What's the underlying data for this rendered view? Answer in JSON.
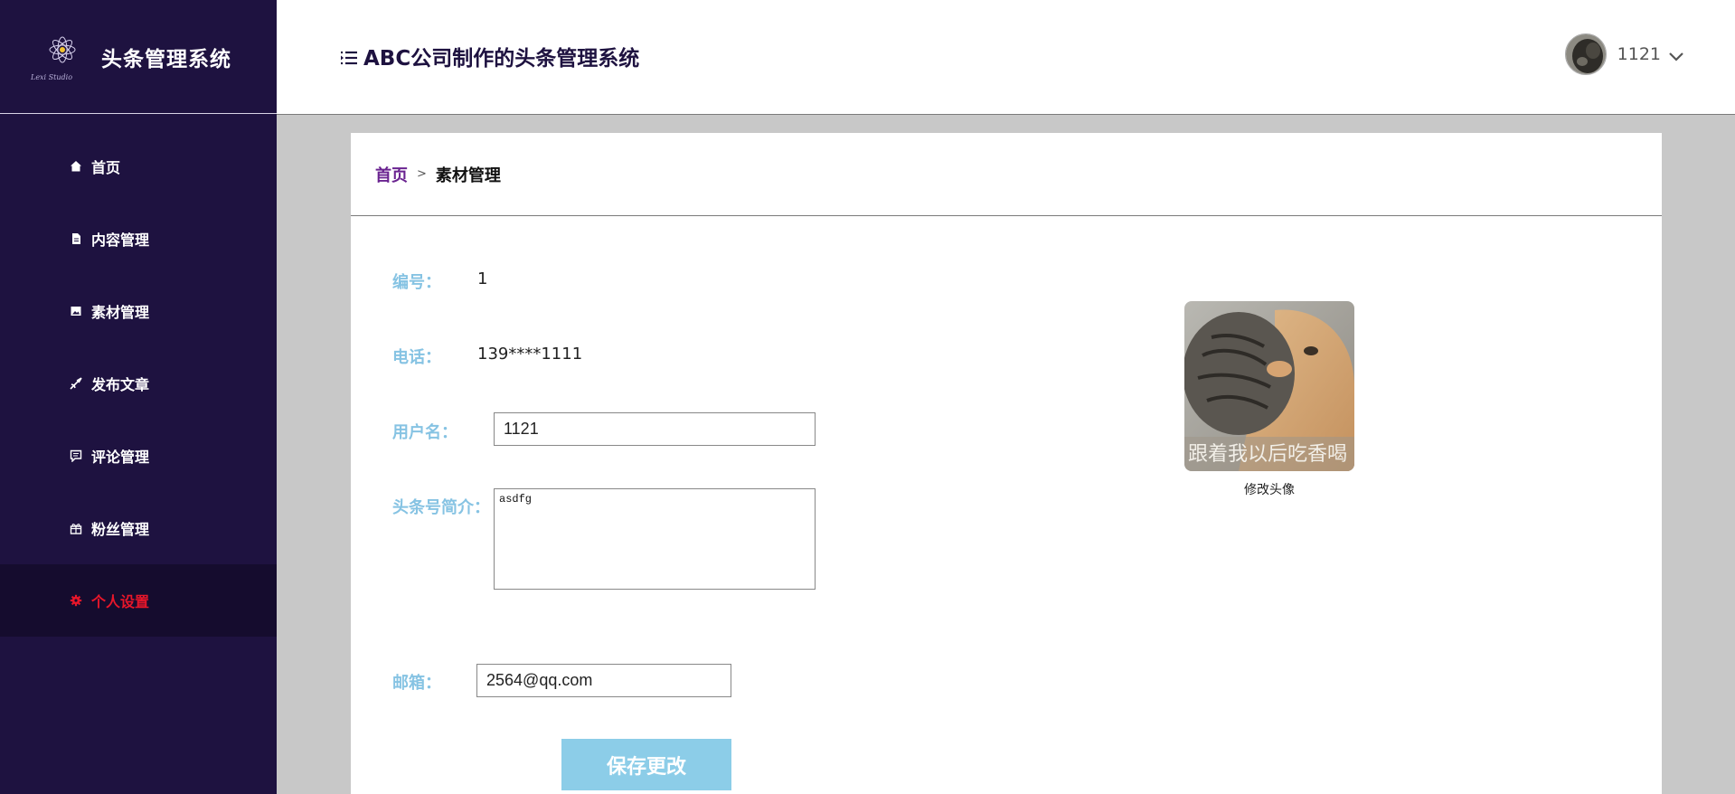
{
  "sidebar": {
    "title": "头条管理系统",
    "logo_text": "Lexi Studio",
    "items": [
      {
        "label": "首页",
        "icon": "home-icon"
      },
      {
        "label": "内容管理",
        "icon": "document-icon"
      },
      {
        "label": "素材管理",
        "icon": "image-icon"
      },
      {
        "label": "发布文章",
        "icon": "send-icon"
      },
      {
        "label": "评论管理",
        "icon": "comment-icon"
      },
      {
        "label": "粉丝管理",
        "icon": "gift-icon"
      },
      {
        "label": "个人设置",
        "icon": "gear-icon",
        "active": true
      }
    ],
    "active_color": "#e8162a"
  },
  "header": {
    "title": "ABC公司制作的头条管理系统",
    "user_name": "1121"
  },
  "breadcrumb": {
    "home": "首页",
    "separator": ">",
    "current": "素材管理"
  },
  "form": {
    "id_label": "编号：",
    "id_value": "1",
    "phone_label": "电话：",
    "phone_value": "139****1111",
    "username_label": "用户名：",
    "username_value": "1121",
    "intro_label": "头条号简介：",
    "intro_value": "asdfg",
    "email_label": "邮箱：",
    "email_value": "2564@qq.com",
    "save_label": "保存更改"
  },
  "avatar": {
    "caption": "修改头像",
    "overlay_text": "跟着我以后吃香喝"
  },
  "colors": {
    "sidebar_bg": "#1e1240",
    "label_color": "#86c3e3",
    "button_bg": "#8ccde8",
    "breadcrumb_home": "#6a2390"
  }
}
